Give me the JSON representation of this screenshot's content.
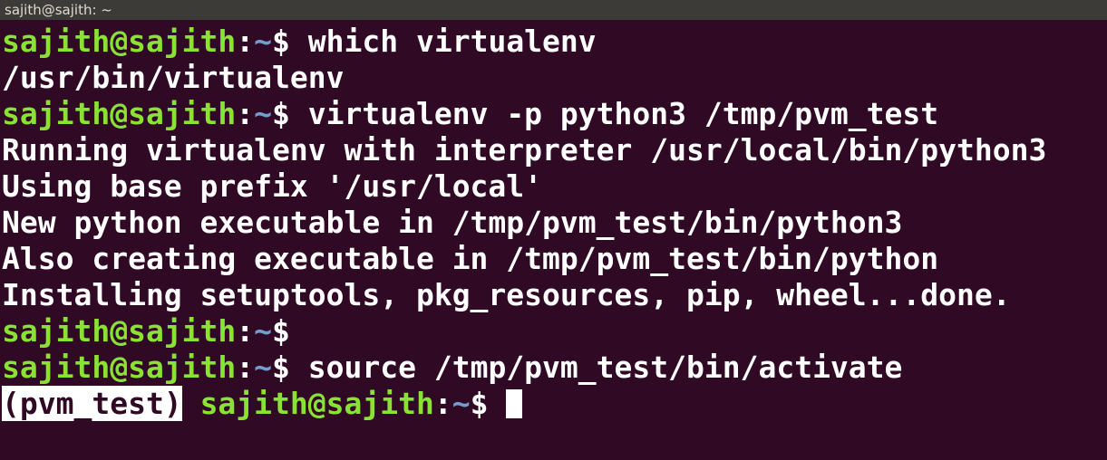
{
  "window": {
    "title": "sajith@sajith: ~"
  },
  "colors": {
    "background": "#300a24",
    "user_host": "#8ae234",
    "path": "#729fcf",
    "text": "#ffffff",
    "titlebar": "#3c3b37"
  },
  "terminal": {
    "prompt_user": "sajith@sajith",
    "prompt_colon": ":",
    "prompt_path": "~",
    "prompt_symbol": "$",
    "venv_label": "(pvm_test)",
    "lines": [
      {
        "type": "prompt",
        "command": " which virtualenv"
      },
      {
        "type": "output",
        "text": "/usr/bin/virtualenv"
      },
      {
        "type": "prompt",
        "command": " virtualenv -p python3 /tmp/pvm_test"
      },
      {
        "type": "output",
        "text": "Running virtualenv with interpreter /usr/local/bin/python3"
      },
      {
        "type": "output",
        "text": "Using base prefix '/usr/local'"
      },
      {
        "type": "output",
        "text": "New python executable in /tmp/pvm_test/bin/python3"
      },
      {
        "type": "output",
        "text": "Also creating executable in /tmp/pvm_test/bin/python"
      },
      {
        "type": "output",
        "text": "Installing setuptools, pkg_resources, pip, wheel...done."
      },
      {
        "type": "prompt",
        "command": ""
      },
      {
        "type": "prompt",
        "command": " source /tmp/pvm_test/bin/activate"
      }
    ]
  }
}
